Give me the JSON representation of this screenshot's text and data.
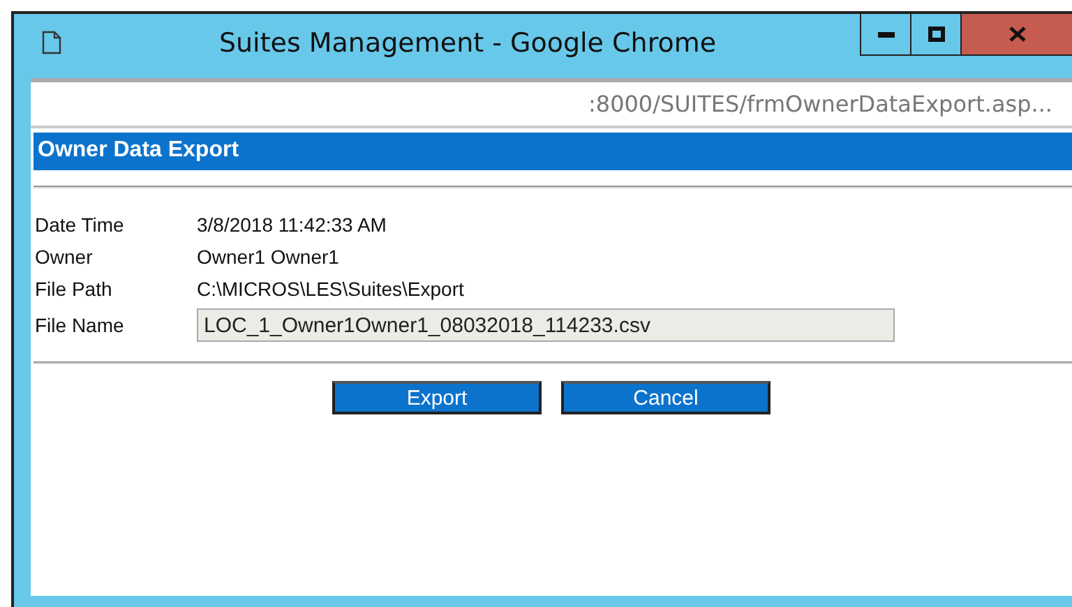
{
  "window": {
    "title": "Suites Management - Google Chrome"
  },
  "address_bar": {
    "url": ":8000/SUITES/frmOwnerDataExport.asp..."
  },
  "page": {
    "heading": "Owner Data Export"
  },
  "fields": [
    {
      "kind": "text",
      "label": "Date Time",
      "value": "3/8/2018 11:42:33 AM"
    },
    {
      "kind": "text",
      "label": "Owner",
      "value": "Owner1 Owner1"
    },
    {
      "kind": "text",
      "label": "File Path",
      "value": "C:\\MICROS\\LES\\Suites\\Export"
    },
    {
      "kind": "input",
      "label": "File Name",
      "value": "LOC_1_Owner1Owner1_08032018_114233.csv",
      "disabled": true
    }
  ],
  "buttons": [
    "Export",
    "Cancel"
  ]
}
